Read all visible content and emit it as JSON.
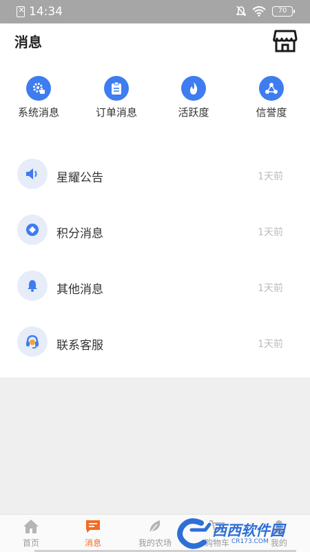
{
  "status_bar": {
    "time": "14:34",
    "battery": "70"
  },
  "header": {
    "title": "消息"
  },
  "quick_actions": [
    {
      "label": "系统消息",
      "icon": "gear-icon"
    },
    {
      "label": "订单消息",
      "icon": "clipboard-icon"
    },
    {
      "label": "活跃度",
      "icon": "flame-icon"
    },
    {
      "label": "信誉度",
      "icon": "share-icon"
    }
  ],
  "messages": [
    {
      "title": "星耀公告",
      "time": "1天前",
      "icon": "speaker-icon"
    },
    {
      "title": "积分消息",
      "time": "1天前",
      "icon": "diamond-icon"
    },
    {
      "title": "其他消息",
      "time": "1天前",
      "icon": "bell-icon"
    },
    {
      "title": "联系客服",
      "time": "1天前",
      "icon": "headset-icon"
    }
  ],
  "tabbar": {
    "items": [
      {
        "label": "首页",
        "icon": "home-icon",
        "active": false
      },
      {
        "label": "消息",
        "icon": "message-icon",
        "active": true
      },
      {
        "label": "我的农场",
        "icon": "leaf-icon",
        "active": false
      },
      {
        "label": "购物车",
        "icon": "cart-icon",
        "active": false
      },
      {
        "label": "我的",
        "icon": "user-icon",
        "active": false
      }
    ]
  },
  "watermark": {
    "text": "西西软件园",
    "sub": "CR173.COM"
  },
  "colors": {
    "accent_blue": "#3e7cf0",
    "active_orange": "#f26b22",
    "status_bar": "#a6a6a6"
  }
}
